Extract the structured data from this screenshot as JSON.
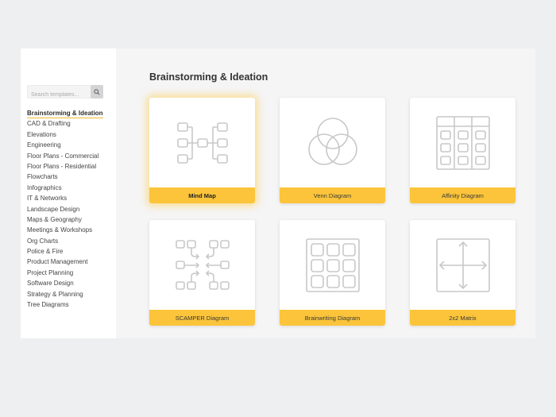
{
  "search": {
    "placeholder": "Search templates..."
  },
  "sidebar": {
    "items": [
      {
        "label": "Brainstorming & Ideation",
        "active": true
      },
      {
        "label": "CAD & Drafting"
      },
      {
        "label": "Elevations"
      },
      {
        "label": "Engineering"
      },
      {
        "label": "Floor Plans - Commercial"
      },
      {
        "label": "Floor Plans - Residential"
      },
      {
        "label": "Flowcharts"
      },
      {
        "label": "Infographics"
      },
      {
        "label": "IT & Networks"
      },
      {
        "label": "Landscape Design"
      },
      {
        "label": "Maps & Geography"
      },
      {
        "label": "Meetings & Workshops"
      },
      {
        "label": "Org Charts"
      },
      {
        "label": "Police & Fire"
      },
      {
        "label": "Product Management"
      },
      {
        "label": "Project Planning"
      },
      {
        "label": "Software Design"
      },
      {
        "label": "Strategy & Planning"
      },
      {
        "label": "Tree Diagrams"
      }
    ]
  },
  "main": {
    "title": "Brainstorming & Ideation",
    "templates": [
      {
        "label": "Mind Map",
        "icon": "mind-map-icon",
        "selected": true
      },
      {
        "label": "Venn Diagram",
        "icon": "venn-diagram-icon"
      },
      {
        "label": "Affinity Diagram",
        "icon": "affinity-diagram-icon"
      },
      {
        "label": "SCAMPER Diagram",
        "icon": "scamper-diagram-icon"
      },
      {
        "label": "Brainwriting Diagram",
        "icon": "brainwriting-diagram-icon"
      },
      {
        "label": "2x2 Matrix",
        "icon": "matrix-2x2-icon"
      }
    ]
  },
  "colors": {
    "accent": "#fbc43a",
    "active_underline": "#f5b82e",
    "icon_stroke": "#c8c8c8"
  }
}
